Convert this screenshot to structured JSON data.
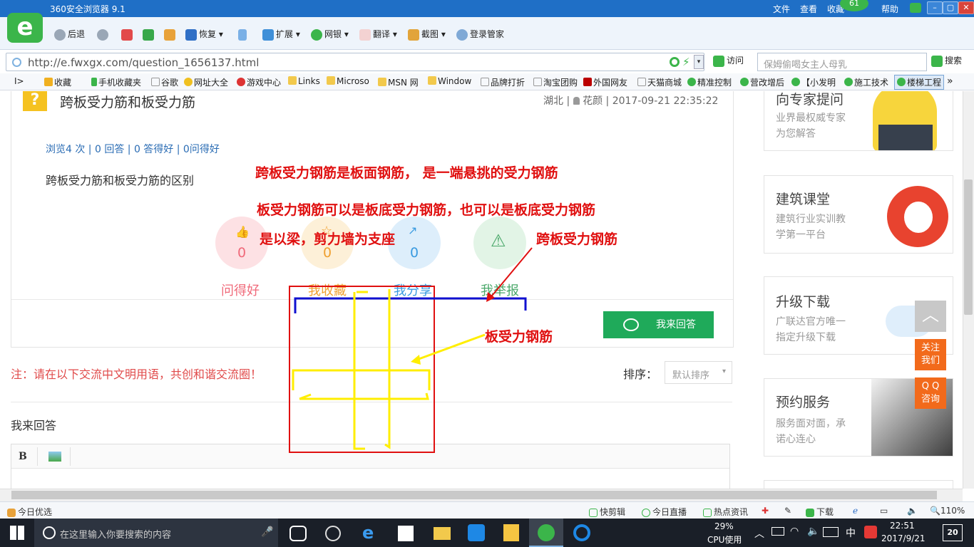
{
  "browser": {
    "title": "360安全浏览器 9.1",
    "menu": [
      "文件",
      "查看",
      "收藏",
      "帮助"
    ],
    "badge": "61",
    "logo_letter": "e",
    "toolbar": [
      "后退",
      "恢复",
      "扩展",
      "网银",
      "翻译",
      "截图",
      "登录管家"
    ],
    "url": "http://e.fwxgx.com/question_1656137.html",
    "visit": "访问",
    "search_placeholder": "保姆偷喝女主人母乳",
    "search_button": "搜索",
    "favorites": [
      "收藏",
      "手机收藏夹",
      "谷歌",
      "网址大全",
      "游戏中心",
      "Links",
      "Microso",
      "MSN 网",
      "Window",
      "品牌打折",
      "淘宝团购",
      "外国网友",
      "天猫商城",
      "精准控制",
      "营改增后",
      "【小发明",
      "施工技术",
      "楼梯工程"
    ]
  },
  "question": {
    "icon": "?",
    "title": "跨板受力筋和板受力筋",
    "meta_region": "湖北 |",
    "meta_user": "花颜",
    "meta_time": "| 2017-09-21 22:35:22",
    "stats": "浏览4 次 | 0 回答 | 0 答得好 | 0问得好",
    "body": "跨板受力筋和板受力筋的区别",
    "actions": [
      {
        "label": "问得好",
        "count": "0",
        "color": "#f06a7a",
        "bg": "#fde1e4"
      },
      {
        "label": "我收藏",
        "count": "0",
        "color": "#f0a030",
        "bg": "#fdf0d8"
      },
      {
        "label": "我分享",
        "count": "0",
        "color": "#3a9be0",
        "bg": "#ddeefb"
      },
      {
        "label": "我举报",
        "count": "",
        "color": "#4aa86a",
        "bg": "#e2f4e6"
      }
    ],
    "answer_button": "我来回答",
    "notice": "注：请在以下交流中文明用语，共创和谐交流圈！",
    "sort_label": "排序：",
    "sort_value": "默认排序",
    "reply_title": "我来回答",
    "editor": {
      "bold": "B"
    }
  },
  "annotations": {
    "line1": "跨板受力钢筋是板面钢筋， 是一端悬挑的受力钢筋",
    "line2": "板受力钢筋可以是板底受力钢筋，也可以是板底受力钢筋",
    "line3": "是以梁，剪力墙为支座",
    "label_cross": "跨板受力钢筋",
    "label_plate": "板受力钢筋"
  },
  "sidebar": {
    "cards": [
      {
        "title": "向专家提问",
        "sub1": "业界最权威专家",
        "sub2": "为您解答"
      },
      {
        "title": "建筑课堂",
        "sub1": "建筑行业实训教",
        "sub2": "学第一平台"
      },
      {
        "title": "升级下载",
        "sub1": "广联达官方唯一",
        "sub2": "指定升级下载"
      },
      {
        "title": "预约服务",
        "sub1": "服务面对面，承",
        "sub2": "诺心连心"
      }
    ],
    "follow": [
      "关注",
      "我们"
    ],
    "qq": [
      "Q Q",
      "咨询"
    ]
  },
  "statusbar": {
    "left": "今日优选",
    "items": [
      "快剪辑",
      "今日直播",
      "热点资讯",
      "下载"
    ],
    "zoom": "110%"
  },
  "taskbar": {
    "search": "在这里输入你要搜索的内容",
    "cpu_pct": "29%",
    "cpu_label": "CPU使用",
    "ime": "中",
    "time": "22:51",
    "date": "2017/9/21",
    "notif": "20"
  }
}
